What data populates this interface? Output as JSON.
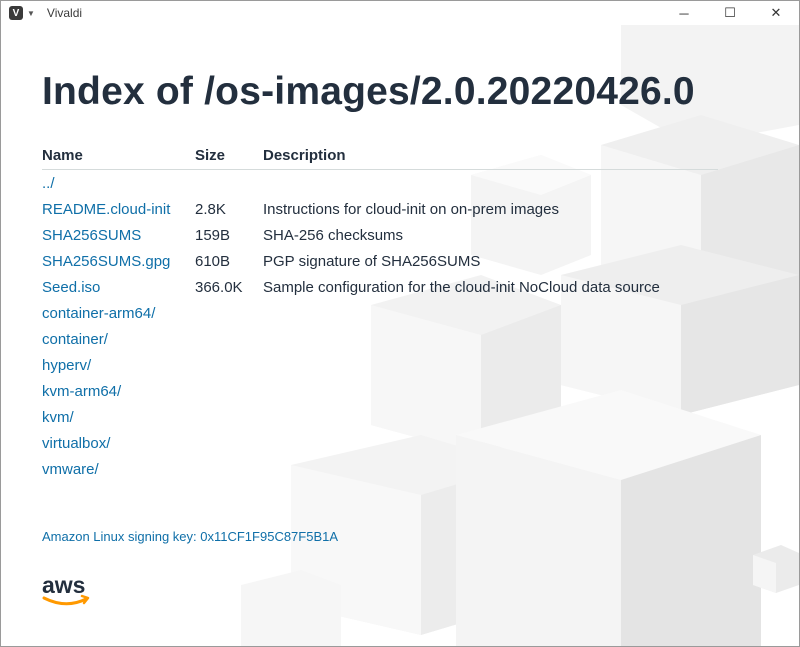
{
  "window": {
    "title": "Vivaldi",
    "minimize_glyph": "─",
    "maximize_glyph": "☐",
    "close_glyph": "✕"
  },
  "page": {
    "heading": "Index of /os-images/2.0.20220426.0",
    "columns": {
      "name": "Name",
      "size": "Size",
      "description": "Description"
    },
    "rows": [
      {
        "name": "../",
        "size": "",
        "description": ""
      },
      {
        "name": "README.cloud-init",
        "size": "2.8K",
        "description": "Instructions for cloud-init on on-prem images"
      },
      {
        "name": "SHA256SUMS",
        "size": "159B",
        "description": "SHA-256 checksums"
      },
      {
        "name": "SHA256SUMS.gpg",
        "size": "610B",
        "description": "PGP signature of SHA256SUMS"
      },
      {
        "name": "Seed.iso",
        "size": "366.0K",
        "description": "Sample configuration for the cloud-init NoCloud data source"
      },
      {
        "name": "container-arm64/",
        "size": "",
        "description": ""
      },
      {
        "name": "container/",
        "size": "",
        "description": ""
      },
      {
        "name": "hyperv/",
        "size": "",
        "description": ""
      },
      {
        "name": "kvm-arm64/",
        "size": "",
        "description": ""
      },
      {
        "name": "kvm/",
        "size": "",
        "description": ""
      },
      {
        "name": "virtualbox/",
        "size": "",
        "description": ""
      },
      {
        "name": "vmware/",
        "size": "",
        "description": ""
      }
    ],
    "signing_key": "Amazon Linux signing key: 0x11CF1F95C87F5B1A",
    "logo_text": "aws"
  },
  "colors": {
    "heading": "#232f3e",
    "link": "#0f6fa8",
    "aws_orange": "#ff9900"
  }
}
